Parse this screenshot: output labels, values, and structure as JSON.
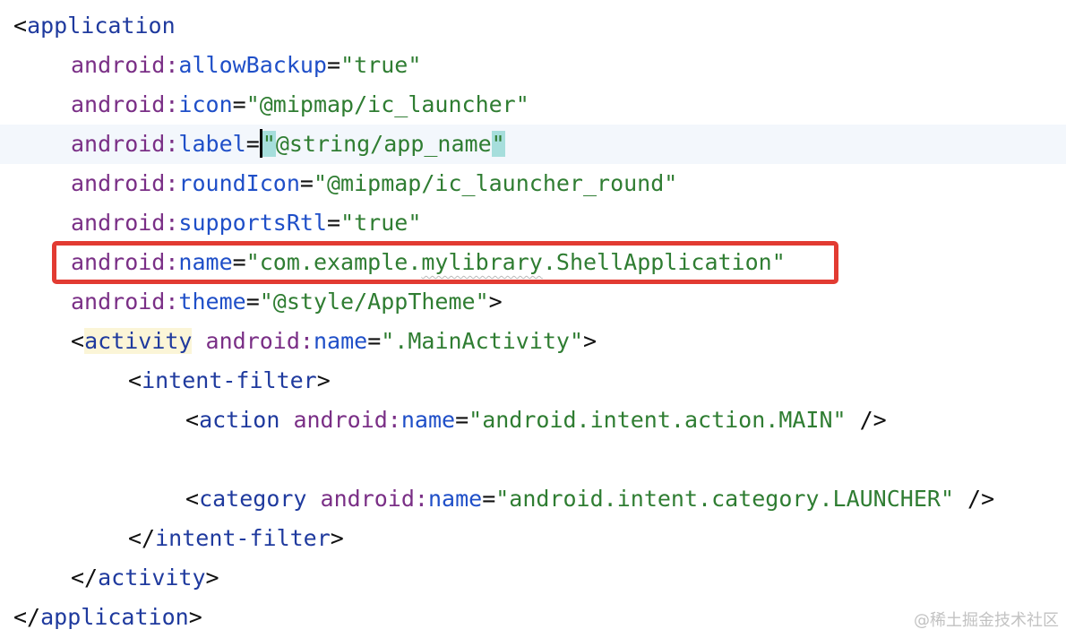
{
  "editor": {
    "lines": [
      {
        "indent": 0,
        "caret_line": false,
        "tokens": [
          {
            "t": "<",
            "c": "br"
          },
          {
            "t": "application",
            "c": "tag"
          }
        ]
      },
      {
        "indent": 1,
        "caret_line": false,
        "tokens": [
          {
            "t": "android",
            "c": "ns"
          },
          {
            "t": ":",
            "c": "ns"
          },
          {
            "t": "allowBackup",
            "c": "attr"
          },
          {
            "t": "=",
            "c": "br"
          },
          {
            "t": "\"true\"",
            "c": "str"
          }
        ]
      },
      {
        "indent": 1,
        "caret_line": false,
        "tokens": [
          {
            "t": "android",
            "c": "ns"
          },
          {
            "t": ":",
            "c": "ns"
          },
          {
            "t": "icon",
            "c": "attr"
          },
          {
            "t": "=",
            "c": "br"
          },
          {
            "t": "\"@mipmap/ic_launcher\"",
            "c": "str"
          }
        ]
      },
      {
        "indent": 1,
        "caret_line": true,
        "tokens": [
          {
            "t": "android",
            "c": "ns"
          },
          {
            "t": ":",
            "c": "ns"
          },
          {
            "t": "label",
            "c": "attr"
          },
          {
            "t": "=",
            "c": "br"
          },
          {
            "t": "CARET",
            "c": "caret"
          },
          {
            "t": "\"",
            "c": "str match"
          },
          {
            "t": "@string/app_name",
            "c": "str"
          },
          {
            "t": "\"",
            "c": "str match"
          }
        ]
      },
      {
        "indent": 1,
        "caret_line": false,
        "tokens": [
          {
            "t": "android",
            "c": "ns"
          },
          {
            "t": ":",
            "c": "ns"
          },
          {
            "t": "roundIcon",
            "c": "attr"
          },
          {
            "t": "=",
            "c": "br"
          },
          {
            "t": "\"@mipmap/ic_launcher_round\"",
            "c": "str"
          }
        ]
      },
      {
        "indent": 1,
        "caret_line": false,
        "tokens": [
          {
            "t": "android",
            "c": "ns"
          },
          {
            "t": ":",
            "c": "ns"
          },
          {
            "t": "supportsRtl",
            "c": "attr"
          },
          {
            "t": "=",
            "c": "br"
          },
          {
            "t": "\"true\"",
            "c": "str"
          }
        ]
      },
      {
        "indent": 1,
        "caret_line": false,
        "tokens": [
          {
            "t": "android",
            "c": "ns"
          },
          {
            "t": ":",
            "c": "ns"
          },
          {
            "t": "name",
            "c": "attr"
          },
          {
            "t": "=",
            "c": "br"
          },
          {
            "t": "\"com.example.",
            "c": "str"
          },
          {
            "t": "mylibrary",
            "c": "str squiggle"
          },
          {
            "t": ".ShellApplication\"",
            "c": "str"
          }
        ]
      },
      {
        "indent": 1,
        "caret_line": false,
        "tokens": [
          {
            "t": "android",
            "c": "ns"
          },
          {
            "t": ":",
            "c": "ns"
          },
          {
            "t": "theme",
            "c": "attr"
          },
          {
            "t": "=",
            "c": "br"
          },
          {
            "t": "\"@style/AppTheme\"",
            "c": "str"
          },
          {
            "t": ">",
            "c": "br"
          }
        ]
      },
      {
        "indent": 1,
        "caret_line": false,
        "tokens": [
          {
            "t": "<",
            "c": "br"
          },
          {
            "t": "activity",
            "c": "tag tag-hl"
          },
          {
            "t": " ",
            "c": "br"
          },
          {
            "t": "android",
            "c": "ns"
          },
          {
            "t": ":",
            "c": "ns"
          },
          {
            "t": "name",
            "c": "attr"
          },
          {
            "t": "=",
            "c": "br"
          },
          {
            "t": "\".MainActivity\"",
            "c": "str"
          },
          {
            "t": ">",
            "c": "br"
          }
        ]
      },
      {
        "indent": 2,
        "caret_line": false,
        "tokens": [
          {
            "t": "<",
            "c": "br"
          },
          {
            "t": "intent-filter",
            "c": "tag"
          },
          {
            "t": ">",
            "c": "br"
          }
        ]
      },
      {
        "indent": 3,
        "caret_line": false,
        "tokens": [
          {
            "t": "<",
            "c": "br"
          },
          {
            "t": "action",
            "c": "tag"
          },
          {
            "t": " ",
            "c": "br"
          },
          {
            "t": "android",
            "c": "ns"
          },
          {
            "t": ":",
            "c": "ns"
          },
          {
            "t": "name",
            "c": "attr"
          },
          {
            "t": "=",
            "c": "br"
          },
          {
            "t": "\"android.intent.action.MAIN\"",
            "c": "str"
          },
          {
            "t": " />",
            "c": "br"
          }
        ]
      },
      {
        "indent": 0,
        "caret_line": false,
        "tokens": []
      },
      {
        "indent": 3,
        "caret_line": false,
        "tokens": [
          {
            "t": "<",
            "c": "br"
          },
          {
            "t": "category",
            "c": "tag"
          },
          {
            "t": " ",
            "c": "br"
          },
          {
            "t": "android",
            "c": "ns"
          },
          {
            "t": ":",
            "c": "ns"
          },
          {
            "t": "name",
            "c": "attr"
          },
          {
            "t": "=",
            "c": "br"
          },
          {
            "t": "\"android.intent.category.LAUNCHER\"",
            "c": "str"
          },
          {
            "t": " />",
            "c": "br"
          }
        ]
      },
      {
        "indent": 2,
        "caret_line": false,
        "tokens": [
          {
            "t": "</",
            "c": "br"
          },
          {
            "t": "intent-filter",
            "c": "tag"
          },
          {
            "t": ">",
            "c": "br"
          }
        ]
      },
      {
        "indent": 1,
        "caret_line": false,
        "tokens": [
          {
            "t": "</",
            "c": "br"
          },
          {
            "t": "activity",
            "c": "tag"
          },
          {
            "t": ">",
            "c": "br"
          }
        ]
      },
      {
        "indent": 0,
        "caret_line": false,
        "tokens": [
          {
            "t": "</",
            "c": "br"
          },
          {
            "t": "application",
            "c": "tag"
          },
          {
            "t": ">",
            "c": "br"
          }
        ]
      }
    ]
  },
  "highlight_color": "#e23b32",
  "watermark": "@稀土掘金技术社区"
}
